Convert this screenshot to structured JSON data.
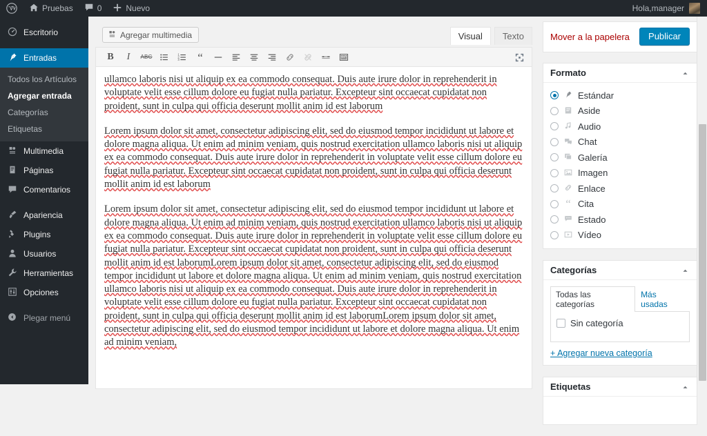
{
  "adminbar": {
    "logo_icon": "wordpress-logo-icon",
    "site": {
      "label": "Pruebas",
      "icon": "home-icon"
    },
    "comments": {
      "count": "0",
      "icon": "comment-bubble-icon"
    },
    "new": {
      "label": "Nuevo",
      "icon": "plus-icon"
    },
    "account": {
      "greeting": "Hola,manager",
      "avatar": "user-avatar"
    }
  },
  "sidebar": {
    "items": [
      {
        "label": "Escritorio",
        "icon": "dashboard-icon",
        "current": false
      },
      {
        "label": "Entradas",
        "icon": "pin-icon",
        "current": true
      },
      {
        "label": "Multimedia",
        "icon": "media-icon",
        "current": false
      },
      {
        "label": "Páginas",
        "icon": "page-icon",
        "current": false
      },
      {
        "label": "Comentarios",
        "icon": "comment-icon",
        "current": false
      },
      {
        "label": "Apariencia",
        "icon": "brush-icon",
        "current": false
      },
      {
        "label": "Plugins",
        "icon": "plugin-icon",
        "current": false
      },
      {
        "label": "Usuarios",
        "icon": "user-icon",
        "current": false
      },
      {
        "label": "Herramientas",
        "icon": "wrench-icon",
        "current": false
      },
      {
        "label": "Opciones",
        "icon": "settings-icon",
        "current": false
      }
    ],
    "submenu": [
      {
        "label": "Todos los Artículos",
        "current": false
      },
      {
        "label": "Agregar entrada",
        "current": true
      },
      {
        "label": "Categorías",
        "current": false
      },
      {
        "label": "Etiquetas",
        "current": false
      }
    ],
    "collapse": {
      "label": "Plegar menú",
      "icon": "collapse-arrow-icon"
    }
  },
  "editor": {
    "add_media_label": "Agregar multimedia",
    "add_media_icon": "media-icon",
    "tabs": [
      {
        "label": "Visual",
        "active": true
      },
      {
        "label": "Texto",
        "active": false
      }
    ],
    "fullscreen_icon": "distraction-free-icon",
    "toolbar": [
      {
        "name": "bold-icon",
        "glyph": "B",
        "disabled": false
      },
      {
        "name": "italic-icon",
        "glyph": "I",
        "disabled": false
      },
      {
        "name": "strikethrough-icon",
        "glyph": "ABC",
        "disabled": false
      },
      {
        "name": "bullet-list-icon",
        "glyph": "☰",
        "disabled": false
      },
      {
        "name": "numbered-list-icon",
        "glyph": "☰",
        "disabled": false
      },
      {
        "name": "blockquote-icon",
        "glyph": "❝",
        "disabled": false
      },
      {
        "name": "horizontal-rule-icon",
        "glyph": "—",
        "disabled": false
      },
      {
        "name": "align-left-icon",
        "glyph": "≡",
        "disabled": false
      },
      {
        "name": "align-center-icon",
        "glyph": "≡",
        "disabled": false
      },
      {
        "name": "align-right-icon",
        "glyph": "≡",
        "disabled": false
      },
      {
        "name": "link-icon",
        "glyph": "🔗",
        "disabled": false
      },
      {
        "name": "unlink-icon",
        "glyph": "🔗",
        "disabled": true
      },
      {
        "name": "insert-more-tag-icon",
        "glyph": "▬",
        "disabled": false
      },
      {
        "name": "toolbar-toggle-icon",
        "glyph": "▦",
        "disabled": false
      }
    ],
    "paragraphs": [
      "ullamco laboris nisi ut aliquip ex ea commodo consequat. Duis aute irure dolor in reprehenderit in voluptate velit esse cillum dolore eu fugiat nulla pariatur. Excepteur sint occaecat cupidatat non proident, sunt in culpa qui officia deserunt mollit anim id est laborum",
      "Lorem ipsum dolor sit amet, consectetur adipiscing elit, sed do eiusmod tempor incididunt ut labore et dolore magna aliqua. Ut enim ad minim veniam, quis nostrud exercitation ullamco laboris nisi ut aliquip ex ea commodo consequat. Duis aute irure dolor in reprehenderit in voluptate velit esse cillum dolore eu fugiat nulla pariatur. Excepteur sint occaecat cupidatat non proident, sunt in culpa qui officia deserunt mollit anim id est laborum",
      "Lorem ipsum dolor sit amet, consectetur adipiscing elit, sed do eiusmod tempor incididunt ut labore et dolore magna aliqua. Ut enim ad minim veniam, quis nostrud exercitation ullamco laboris nisi ut aliquip ex ea commodo consequat. Duis aute irure dolor in reprehenderit in voluptate velit esse cillum dolore eu fugiat nulla pariatur. Excepteur sint occaecat cupidatat non proident, sunt in culpa qui officia deserunt mollit anim id est laborumLorem ipsum dolor sit amet, consectetur adipiscing elit, sed do eiusmod tempor incididunt ut labore et dolore magna aliqua. Ut enim ad minim veniam, quis nostrud exercitation ullamco laboris nisi ut aliquip ex ea commodo consequat. Duis aute irure dolor in reprehenderit in voluptate velit esse cillum dolore eu fugiat nulla pariatur. Excepteur sint occaecat cupidatat non proident, sunt in culpa qui officia deserunt mollit anim id est laborumLorem ipsum dolor sit amet, consectetur adipiscing elit, sed do eiusmod tempor incididunt ut labore et dolore magna aliqua. Ut enim ad minim veniam,"
    ]
  },
  "publish_box": {
    "trash_label": "Mover a la papelera",
    "publish_label": "Publicar"
  },
  "format_box": {
    "title": "Formato",
    "toggle_icon": "chevron-up-icon",
    "options": [
      {
        "label": "Estándar",
        "icon": "pin-icon",
        "selected": true
      },
      {
        "label": "Aside",
        "icon": "aside-icon",
        "selected": false
      },
      {
        "label": "Audio",
        "icon": "audio-note-icon",
        "selected": false
      },
      {
        "label": "Chat",
        "icon": "chat-icon",
        "selected": false
      },
      {
        "label": "Galería",
        "icon": "gallery-icon",
        "selected": false
      },
      {
        "label": "Imagen",
        "icon": "image-icon",
        "selected": false
      },
      {
        "label": "Enlace",
        "icon": "link-icon",
        "selected": false
      },
      {
        "label": "Cita",
        "icon": "quote-icon",
        "selected": false
      },
      {
        "label": "Estado",
        "icon": "status-bubble-icon",
        "selected": false
      },
      {
        "label": "Vídeo",
        "icon": "video-icon",
        "selected": false
      }
    ]
  },
  "categories_box": {
    "title": "Categorías",
    "toggle_icon": "chevron-up-icon",
    "tabs": [
      {
        "label": "Todas las categorías",
        "active": true
      },
      {
        "label": "Más usadas",
        "active": false
      }
    ],
    "items": [
      {
        "label": "Sin categoría",
        "checked": false
      }
    ],
    "add_link": "+ Agregar nueva categoría"
  },
  "tags_box": {
    "title": "Etiquetas",
    "toggle_icon": "chevron-up-icon"
  },
  "colors": {
    "admin_dark": "#23282d",
    "admin_submenu": "#32373c",
    "accent_blue": "#0073aa",
    "publish_blue": "#0085ba",
    "trash_red": "#a00",
    "page_bg": "#f1f1f1"
  }
}
